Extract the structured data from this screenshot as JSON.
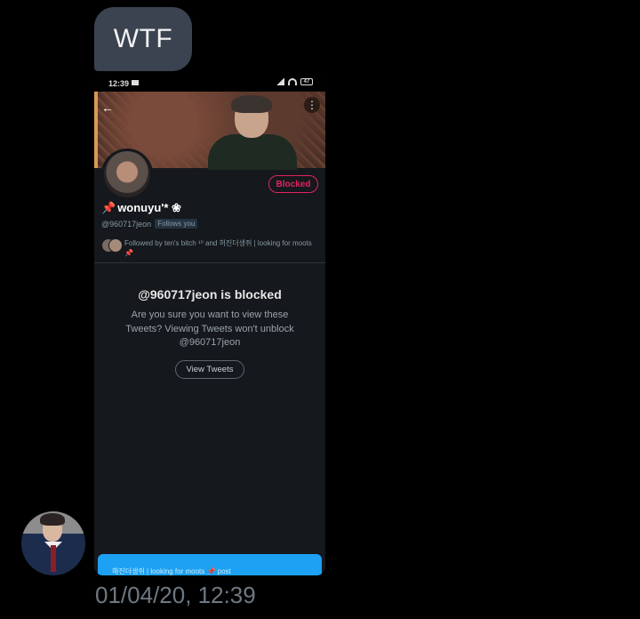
{
  "message": {
    "text": "WTF",
    "timestamp": "01/04/20, 12:39"
  },
  "screenshot": {
    "status_time": "12:39",
    "battery": "47",
    "profile": {
      "name": "wonuyu'* ❀",
      "pin_emoji": "📌",
      "handle": "@960717jeon",
      "follows_you": "Follows you",
      "blocked_label": "Blocked",
      "followed_by": "Followed by ten's bitch ¹⁰ and 허진더생쥐 | looking for moots📌"
    },
    "blocked_notice": {
      "title": "@960717jeon is blocked",
      "description": "Are you sure you want to view these Tweets? Viewing Tweets won't unblock @960717jeon",
      "button": "View Tweets"
    },
    "toast_text": "해진더생쥐 | looking for moots 📌 post"
  },
  "colors": {
    "bubble": "#3b4350",
    "accent_blocked": "#e0245e",
    "twitter_blue": "#1da1f2"
  }
}
